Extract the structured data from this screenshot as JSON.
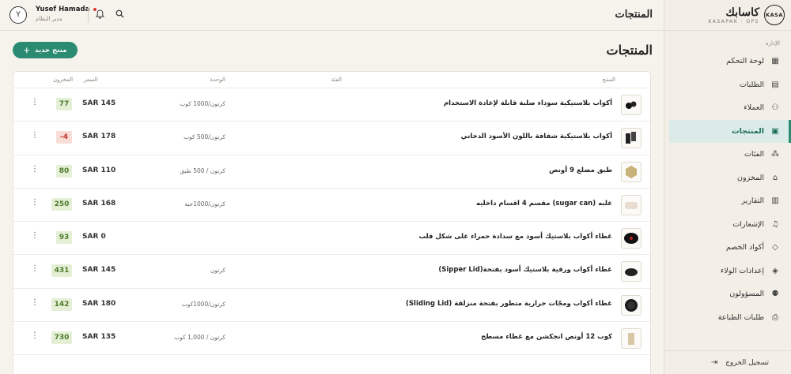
{
  "header": {
    "title": "المنتجات",
    "user_initial": "Y",
    "user_name": "Yusef Hamada",
    "user_role": "مدير النظام"
  },
  "brand": {
    "name_ar": "كاسابك",
    "name_en": "KASAPAK · OPS",
    "logo": "KASA"
  },
  "sidebar": {
    "section": "الإدارة",
    "items": [
      {
        "label": "لوحة التحكم",
        "icon": "dashboard-icon",
        "glyph": "▦"
      },
      {
        "label": "الطلبات",
        "icon": "orders-icon",
        "glyph": "▤"
      },
      {
        "label": "العملاء",
        "icon": "customers-icon",
        "glyph": "⚇"
      },
      {
        "label": "المنتجات",
        "icon": "products-icon",
        "glyph": "▣",
        "active": true
      },
      {
        "label": "الفئات",
        "icon": "categories-icon",
        "glyph": "⁂"
      },
      {
        "label": "المخزون",
        "icon": "warehouse-icon",
        "glyph": "⌂"
      },
      {
        "label": "التقارير",
        "icon": "reports-icon",
        "glyph": "▥"
      },
      {
        "label": "الإشعارات",
        "icon": "notifications-icon",
        "glyph": "♫"
      },
      {
        "label": "أكواد الخصم",
        "icon": "discount-tag-icon",
        "glyph": "◇"
      },
      {
        "label": "إعدادات الولاء",
        "icon": "loyalty-tag-icon",
        "glyph": "◈"
      },
      {
        "label": "المسؤولون",
        "icon": "admins-icon",
        "glyph": "⚉"
      },
      {
        "label": "طلبات الطباعة",
        "icon": "printer-icon",
        "glyph": "⎙"
      }
    ],
    "logout": "تسجيل الخروج"
  },
  "page": {
    "title": "المنتجات",
    "new_button": "منتج جديد"
  },
  "table": {
    "columns": {
      "product": "المنتج",
      "category": "الفئة",
      "unit": "الوحدة",
      "price": "السعر",
      "stock": "المخزون"
    },
    "rows": [
      {
        "name": "أكواب بلاستيكية سوداء صلبة قابلة لإعادة الاستخدام",
        "unit": "كرتون/1000 كوب",
        "price": "SAR 145",
        "stock": "77",
        "negative": false
      },
      {
        "name": "أكواب بلاستيكية شفافة باللون الأسود الدخاني",
        "unit": "كرتون/500 كوب",
        "price": "SAR 178",
        "stock": "-4",
        "negative": true
      },
      {
        "name": "طبق مضلع 9 أونص",
        "unit": "كرتون / 500 طبق",
        "price": "SAR 110",
        "stock": "80",
        "negative": false
      },
      {
        "name": "علبه (sugar can) مقسم 4 اقسام داخليه",
        "unit": "كرتون/1000حبه",
        "price": "SAR 168",
        "stock": "250",
        "negative": false
      },
      {
        "name": "غطاء أكواب بلاستيك أسود مع سدادة حمراء على شكل قلب",
        "unit": "",
        "price": "SAR 0",
        "stock": "93",
        "negative": false
      },
      {
        "name": "غطاء أكواب ورقية بلاستيك أسود بفتحة(Sipper Lid)",
        "unit": "كرتون",
        "price": "SAR 145",
        "stock": "431",
        "negative": false
      },
      {
        "name": "غطاء أكواب ومجّات حرارية متطور بفتحة منزلقة (Sliding Lid)",
        "unit": "كرتون/1000كوب",
        "price": "SAR 180",
        "stock": "142",
        "negative": false
      },
      {
        "name": "كوب 12 أونص انجكشن مع غطاء مسطح",
        "unit": "كرتون / 1,000 كوب",
        "price": "SAR 135",
        "stock": "730",
        "negative": false
      }
    ]
  }
}
